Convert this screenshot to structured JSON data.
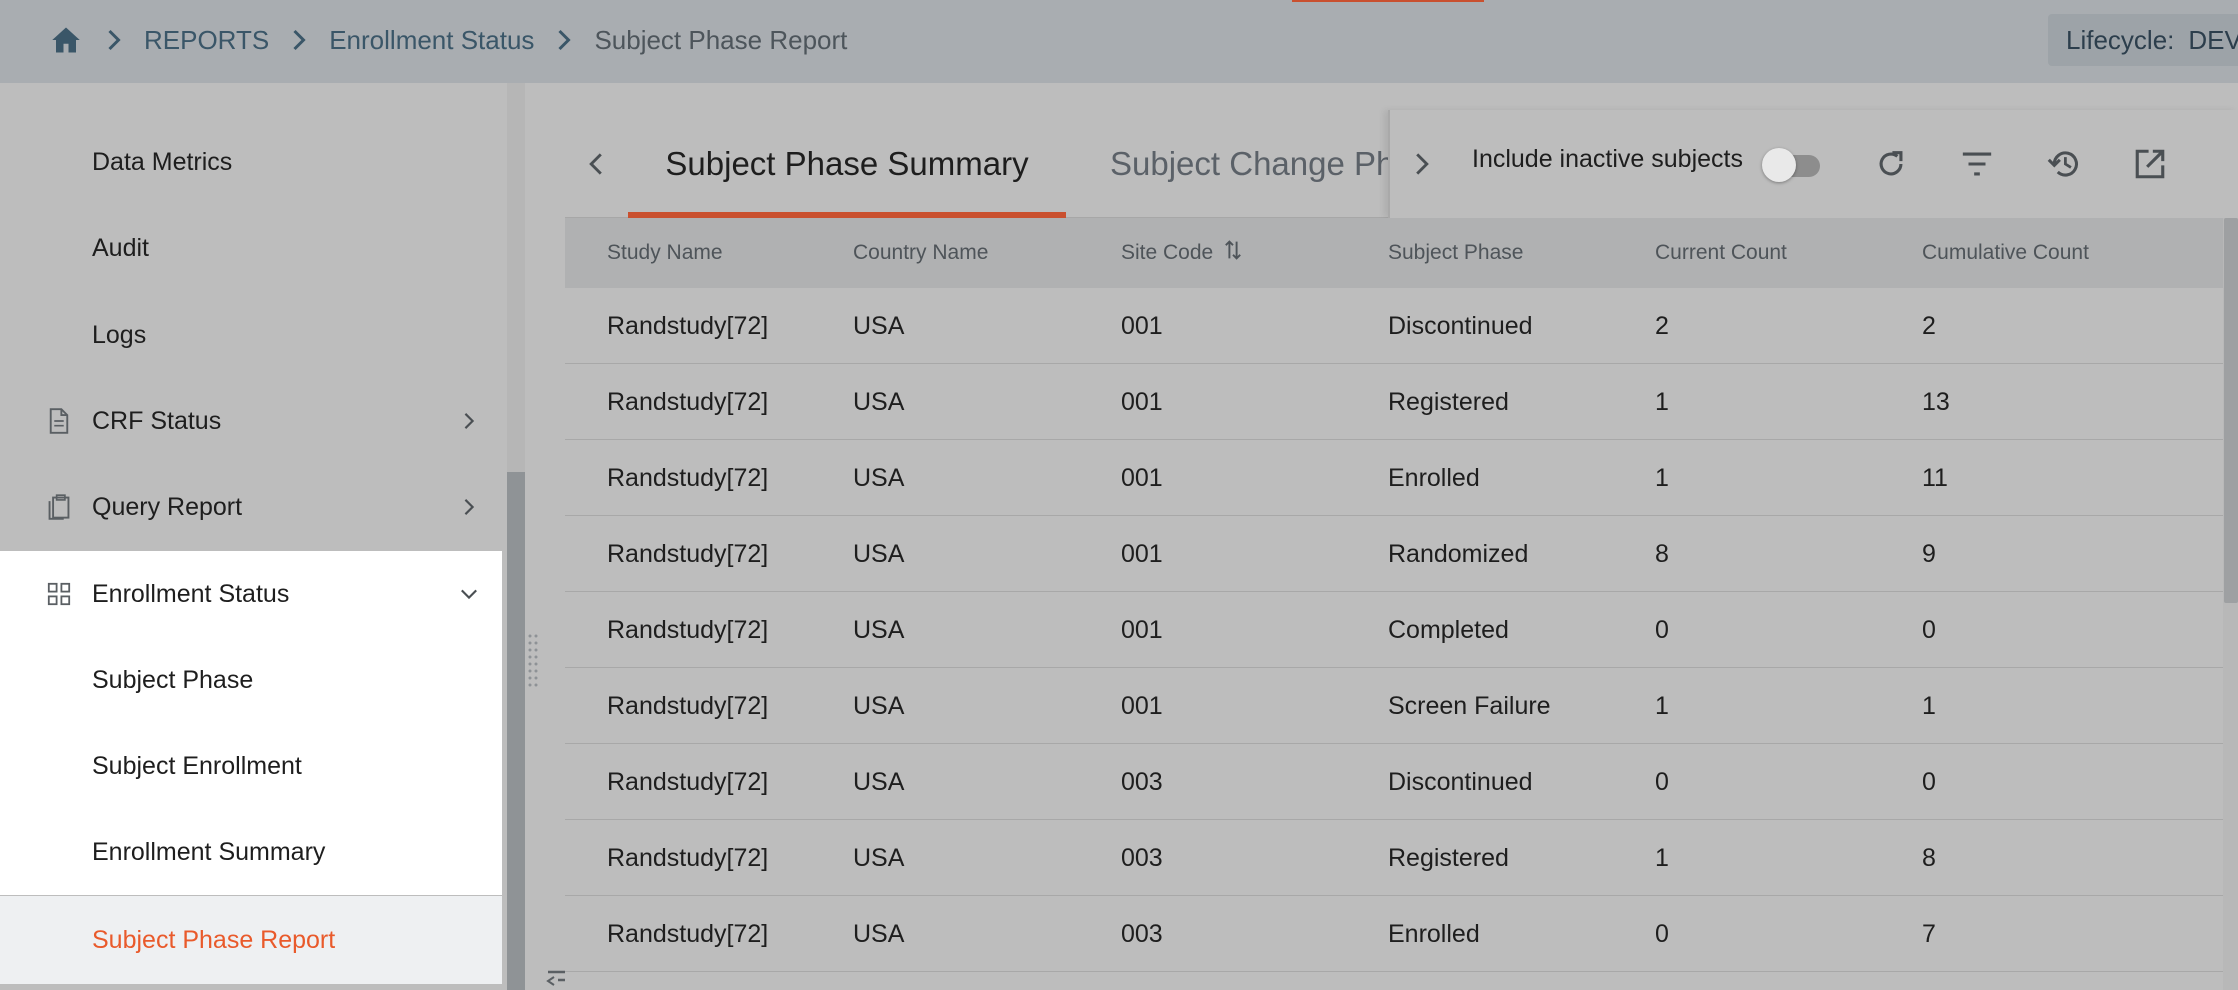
{
  "breadcrumb": {
    "items": [
      {
        "label": "REPORTS"
      },
      {
        "label": "Enrollment Status"
      },
      {
        "label": "Subject Phase Report"
      }
    ]
  },
  "lifecycle": {
    "label": "Lifecycle:",
    "value": "DEV"
  },
  "sidebar": {
    "items": [
      {
        "label": "Data Metrics"
      },
      {
        "label": "Audit"
      },
      {
        "label": "Logs"
      },
      {
        "label": "CRF Status"
      },
      {
        "label": "Query Report"
      },
      {
        "label": "Enrollment Status"
      },
      {
        "label": "Subject Phase"
      },
      {
        "label": "Subject Enrollment"
      },
      {
        "label": "Enrollment Summary"
      },
      {
        "label": "Subject Phase Report"
      }
    ]
  },
  "tabs": [
    {
      "label": "Subject Phase Summary",
      "active": true
    },
    {
      "label": "Subject Change Phase",
      "active": false
    }
  ],
  "toolbar": {
    "include_inactive_label": "Include inactive subjects",
    "include_inactive_value": false
  },
  "table": {
    "columns": [
      "Study Name",
      "Country Name",
      "Site Code",
      "Subject Phase",
      "Current Count",
      "Cumulative Count"
    ],
    "rows": [
      [
        "Randstudy[72]",
        "USA",
        "001",
        "Discontinued",
        "2",
        "2"
      ],
      [
        "Randstudy[72]",
        "USA",
        "001",
        "Registered",
        "1",
        "13"
      ],
      [
        "Randstudy[72]",
        "USA",
        "001",
        "Enrolled",
        "1",
        "11"
      ],
      [
        "Randstudy[72]",
        "USA",
        "001",
        "Randomized",
        "8",
        "9"
      ],
      [
        "Randstudy[72]",
        "USA",
        "001",
        "Completed",
        "0",
        "0"
      ],
      [
        "Randstudy[72]",
        "USA",
        "001",
        "Screen Failure",
        "1",
        "1"
      ],
      [
        "Randstudy[72]",
        "USA",
        "003",
        "Discontinued",
        "0",
        "0"
      ],
      [
        "Randstudy[72]",
        "USA",
        "003",
        "Registered",
        "1",
        "8"
      ],
      [
        "Randstudy[72]",
        "USA",
        "003",
        "Enrolled",
        "0",
        "7"
      ]
    ]
  },
  "colors": {
    "accent": "#e95a2b",
    "tab_underline": "#c9502f",
    "link": "#3a5668"
  }
}
